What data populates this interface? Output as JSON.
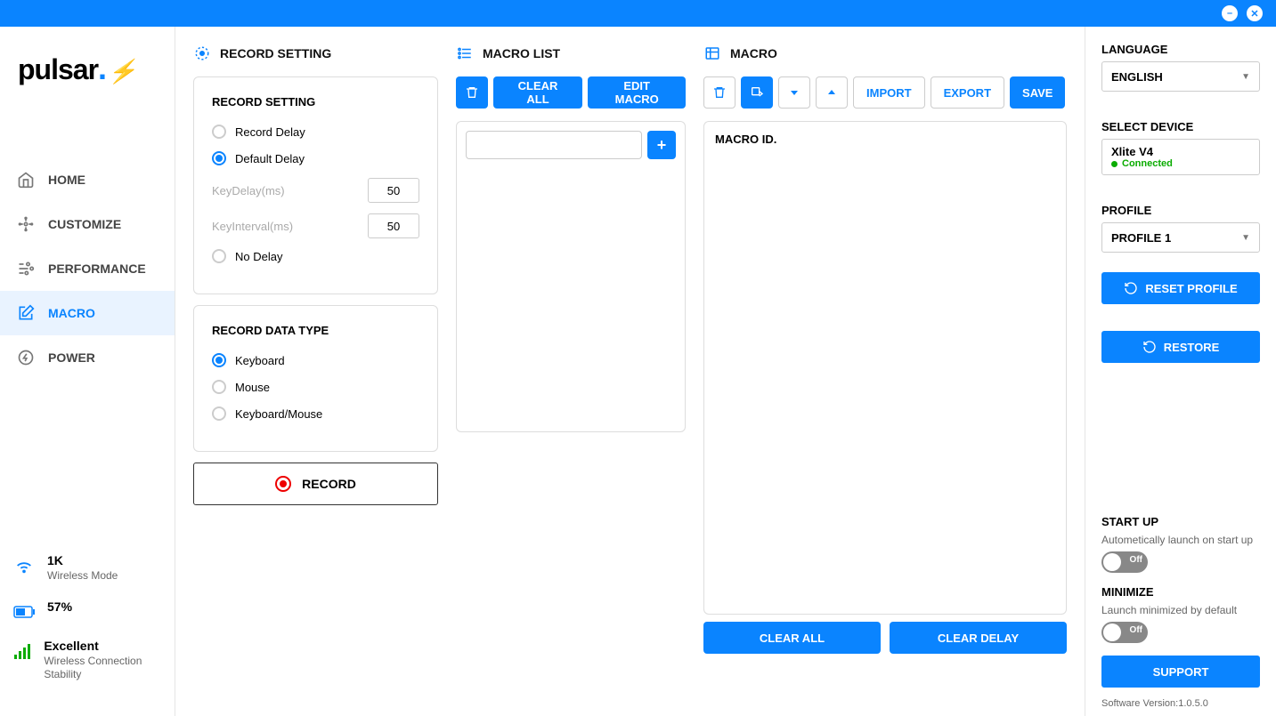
{
  "titlebar": {
    "minimize": "–",
    "close": "✕"
  },
  "logo": "pulsar",
  "nav": {
    "home": "HOME",
    "customize": "CUSTOMIZE",
    "performance": "PERFORMANCE",
    "macro": "MACRO",
    "power": "POWER"
  },
  "status": {
    "rate": "1K",
    "rate_sub": "Wireless Mode",
    "battery": "57%",
    "signal": "Excellent",
    "signal_sub": "Wireless Connection Stability"
  },
  "record_setting": {
    "header": "RECORD SETTING",
    "card_title": "RECORD SETTING",
    "record_delay": "Record Delay",
    "default_delay": "Default Delay",
    "key_delay_label": "KeyDelay(ms)",
    "key_delay_value": "50",
    "key_interval_label": "KeyInterval(ms)",
    "key_interval_value": "50",
    "no_delay": "No Delay",
    "data_type_title": "RECORD DATA TYPE",
    "keyboard": "Keyboard",
    "mouse": "Mouse",
    "keyboard_mouse": "Keyboard/Mouse",
    "record_btn": "RECORD"
  },
  "macro_list": {
    "header": "MACRO LIST",
    "clear_all": "CLEAR ALL",
    "edit_macro": "EDIT MACRO"
  },
  "macro": {
    "header": "MACRO",
    "import": "IMPORT",
    "export": "EXPORT",
    "save": "SAVE",
    "macro_id": "MACRO ID.",
    "clear_all": "CLEAR ALL",
    "clear_delay": "CLEAR DELAY"
  },
  "right": {
    "language_label": "LANGUAGE",
    "language_value": "ENGLISH",
    "select_device_label": "SELECT DEVICE",
    "device_name": "Xlite V4",
    "device_status": "Connected",
    "profile_label": "PROFILE",
    "profile_value": "PROFILE 1",
    "reset_profile": "RESET PROFILE",
    "restore": "RESTORE",
    "startup_label": "START UP",
    "startup_sub": "Autometically launch on start up",
    "startup_toggle": "Off",
    "minimize_label": "MINIMIZE",
    "minimize_sub": "Launch minimized by default",
    "minimize_toggle": "Off",
    "support": "SUPPORT",
    "version_label": "Software Version:",
    "version_value": "1.0.5.0"
  }
}
